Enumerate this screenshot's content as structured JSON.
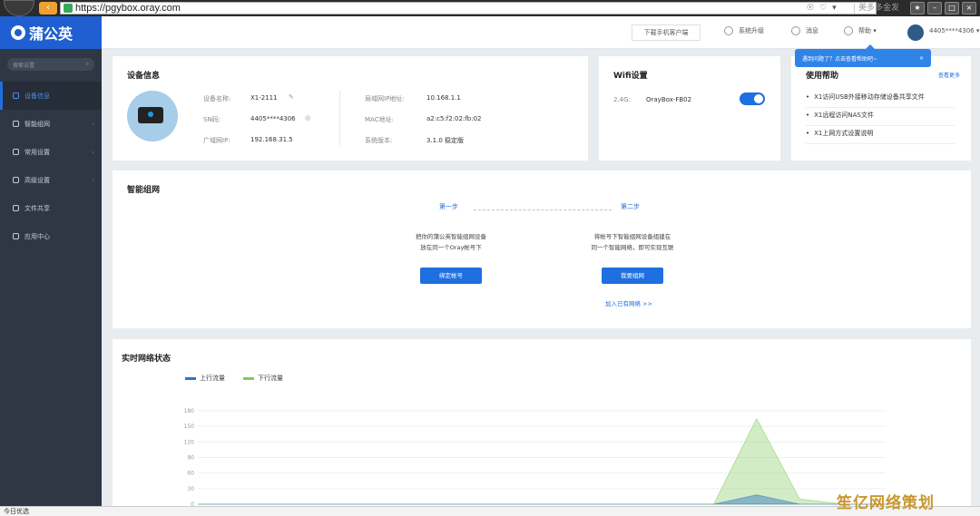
{
  "browser": {
    "url": "https://pgybox.oray.com",
    "back_label": "‹",
    "search_placeholder": "美多多金发",
    "tool_icons": [
      "☉",
      "♡",
      "▾"
    ],
    "window_buttons": [
      "★",
      "–",
      "□",
      "×"
    ]
  },
  "sidebar": {
    "brand": "蒲公英",
    "search_placeholder": "搜索设置",
    "items": [
      {
        "label": "设备信息",
        "icon": "device-icon",
        "active": true
      },
      {
        "label": "智能组网",
        "icon": "network-icon",
        "chevron": "›"
      },
      {
        "label": "常用设置",
        "icon": "settings-icon",
        "chevron": "›"
      },
      {
        "label": "高级设置",
        "icon": "advanced-icon",
        "chevron": "›"
      },
      {
        "label": "文件共享",
        "icon": "folder-icon"
      },
      {
        "label": "应用中心",
        "icon": "apps-icon"
      }
    ]
  },
  "header": {
    "download_client": "下载手机客户端",
    "system_upgrade": "系统升级",
    "messages": "消息",
    "help": "帮助 ▾",
    "account": "4405****4306 ▾"
  },
  "tooltip": {
    "text": "遇到问题了？点击查看帮助吧~",
    "close": "×"
  },
  "device_info": {
    "title": "设备信息",
    "edit_icon": "✎",
    "eye_icon": "◎",
    "left": [
      {
        "label": "设备名称:",
        "value": "X1-2111"
      },
      {
        "label": "SN码:",
        "value": "4405****4306"
      },
      {
        "label": "广域网IP:",
        "value": "192.168.31.5"
      }
    ],
    "right": [
      {
        "label": "局域网IP地址:",
        "value": "10.168.1.1"
      },
      {
        "label": "MAC地址:",
        "value": "a2:c5:f2:02:fb:02"
      },
      {
        "label": "系统版本:",
        "value": "3.1.0 稳定版"
      }
    ]
  },
  "wifi": {
    "title": "Wifi设置",
    "band": "2.4G:",
    "ssid": "OrayBox-FB02",
    "enabled": true
  },
  "help_panel": {
    "title": "使用帮助",
    "more": "查看更多",
    "items": [
      "X1访问USB外接移动存储设备共享文件",
      "X1远程访问NAS文件",
      "X1上网方式设置说明"
    ]
  },
  "smart_network": {
    "title": "智能组网",
    "step1": "第一步",
    "step2": "第二步",
    "step1_desc_1": "把你的蒲公英智能组网设备",
    "step1_desc_2": "放在同一个Oray帐号下",
    "step2_desc_1": "将帐号下智能组网设备组建在",
    "step2_desc_2": "同一个智能网络，即可实现互联",
    "bind_button": "绑定帐号",
    "create_button": "我要组网",
    "join_link": "加入已有网络 >>"
  },
  "traffic": {
    "title": "实时网络状态"
  },
  "chart_data": {
    "type": "area",
    "series": [
      {
        "name": "上行流量",
        "color": "#2f74c4",
        "values": [
          0,
          0,
          0,
          0,
          0,
          0,
          0,
          0,
          0,
          0,
          0,
          0,
          0,
          18,
          0,
          0,
          0
        ]
      },
      {
        "name": "下行流量",
        "color": "#7fca5a",
        "values": [
          0,
          0,
          0,
          0,
          0,
          0,
          0,
          0,
          0,
          0,
          0,
          0,
          0,
          165,
          10,
          0,
          0
        ]
      }
    ],
    "yticks": [
      "180",
      "150",
      "120",
      "90",
      "60",
      "30",
      "0"
    ],
    "ylim": [
      0,
      180
    ],
    "grid": true
  },
  "status_bar": {
    "text": "今日优选"
  },
  "watermark": "笙亿网络策划"
}
